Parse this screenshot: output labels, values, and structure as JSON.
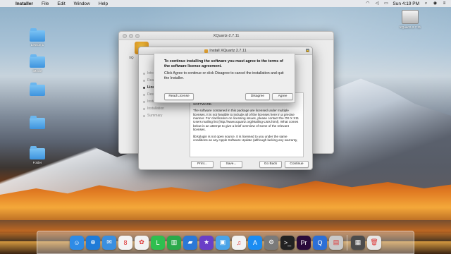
{
  "menubar": {
    "apple": "",
    "items": [
      "Installer",
      "File",
      "Edit",
      "Window",
      "Help"
    ],
    "clock": "Sun 4:19 PM",
    "status_icons": [
      "wifi-icon",
      "volume-icon",
      "battery-icon",
      "spotlight-icon",
      "siri-icon",
      "notifications-icon"
    ]
  },
  "desktop": {
    "folders": [
      "Lesson 1",
      "iMovie",
      "",
      "",
      "Folder"
    ],
    "drive_label": "XQuartz-2.7.11"
  },
  "finder": {
    "title": "XQuartz-2.7.11",
    "item_label": "XQ"
  },
  "installer": {
    "title": "Install XQuartz 2.7.11",
    "steps": [
      "Introduction",
      "Read Me",
      "License",
      "Destination Select",
      "Installation Type",
      "Installation",
      "Summary"
    ],
    "active_step": 2,
    "license_paragraphs": [
      "OTHERWISE, ARISING FROM, OUT OF OR IN CONNECTION WITH THE SOFTWARE OR THE USE OR OTHER DEALINGS IN THE SOFTWARE.",
      "The software contained in this package are licensed under multiple licenses. It is not feasible to include all of the licenses here in a precise manner. For clarification on licensing issues, please contact the OS X X11 Users mailing list (http://www.xquartz.org/Mailing-Lists.html). What comes below is an attempt to give a brief overview of some of the relevant licenses.",
      "libXplugin is not open source. It is licensed to you under the same conditions as any Apple Software Update (although lacking any warranty,"
    ],
    "buttons": {
      "print": "Print...",
      "save": "Save...",
      "go_back": "Go Back",
      "continue": "Continue"
    }
  },
  "sheet": {
    "heading": "To continue installing the software you must agree to the terms of the software license agreement.",
    "body": "Click Agree to continue or click Disagree to cancel the installation and quit the Installer.",
    "read_license": "Read License",
    "disagree": "Disagree",
    "agree": "Agree"
  },
  "dock": {
    "apps": [
      {
        "name": "finder-icon",
        "glyph": "☺",
        "color": "#2e8be6"
      },
      {
        "name": "safari-icon",
        "glyph": "⊕",
        "color": "#1f7bd8"
      },
      {
        "name": "mail-icon",
        "glyph": "✉",
        "color": "#3a8fe0"
      },
      {
        "name": "calendar-icon",
        "glyph": "8",
        "color": "#f4f4f4"
      },
      {
        "name": "photos-icon",
        "glyph": "✿",
        "color": "#f2f2f2"
      },
      {
        "name": "line-icon",
        "glyph": "L",
        "color": "#2fbf4f"
      },
      {
        "name": "numbers-icon",
        "glyph": "▥",
        "color": "#2aa94a"
      },
      {
        "name": "keynote-icon",
        "glyph": "▰",
        "color": "#2b78d6"
      },
      {
        "name": "imovie-icon",
        "glyph": "★",
        "color": "#6a3fc7"
      },
      {
        "name": "preview-icon",
        "glyph": "▣",
        "color": "#4aa3e8"
      },
      {
        "name": "music-icon",
        "glyph": "♫",
        "color": "#f2f2f2"
      },
      {
        "name": "app-store-icon",
        "glyph": "A",
        "color": "#1b8cf2"
      },
      {
        "name": "system-preferences-icon",
        "glyph": "⚙",
        "color": "#7a7a7a"
      },
      {
        "name": "terminal-icon",
        "glyph": ">_",
        "color": "#222222"
      },
      {
        "name": "premiere-icon",
        "glyph": "Pr",
        "color": "#2a0a3a"
      },
      {
        "name": "quicktime-icon",
        "glyph": "Q",
        "color": "#2c6fd6"
      },
      {
        "name": "installer-icon",
        "glyph": "▤",
        "color": "#c9c9c9"
      }
    ],
    "trailing": [
      {
        "name": "downloads-icon",
        "glyph": "▦",
        "color": "#4c4c4c"
      },
      {
        "name": "trash-icon",
        "glyph": "🗑",
        "color": "#e6e6e6"
      }
    ]
  }
}
